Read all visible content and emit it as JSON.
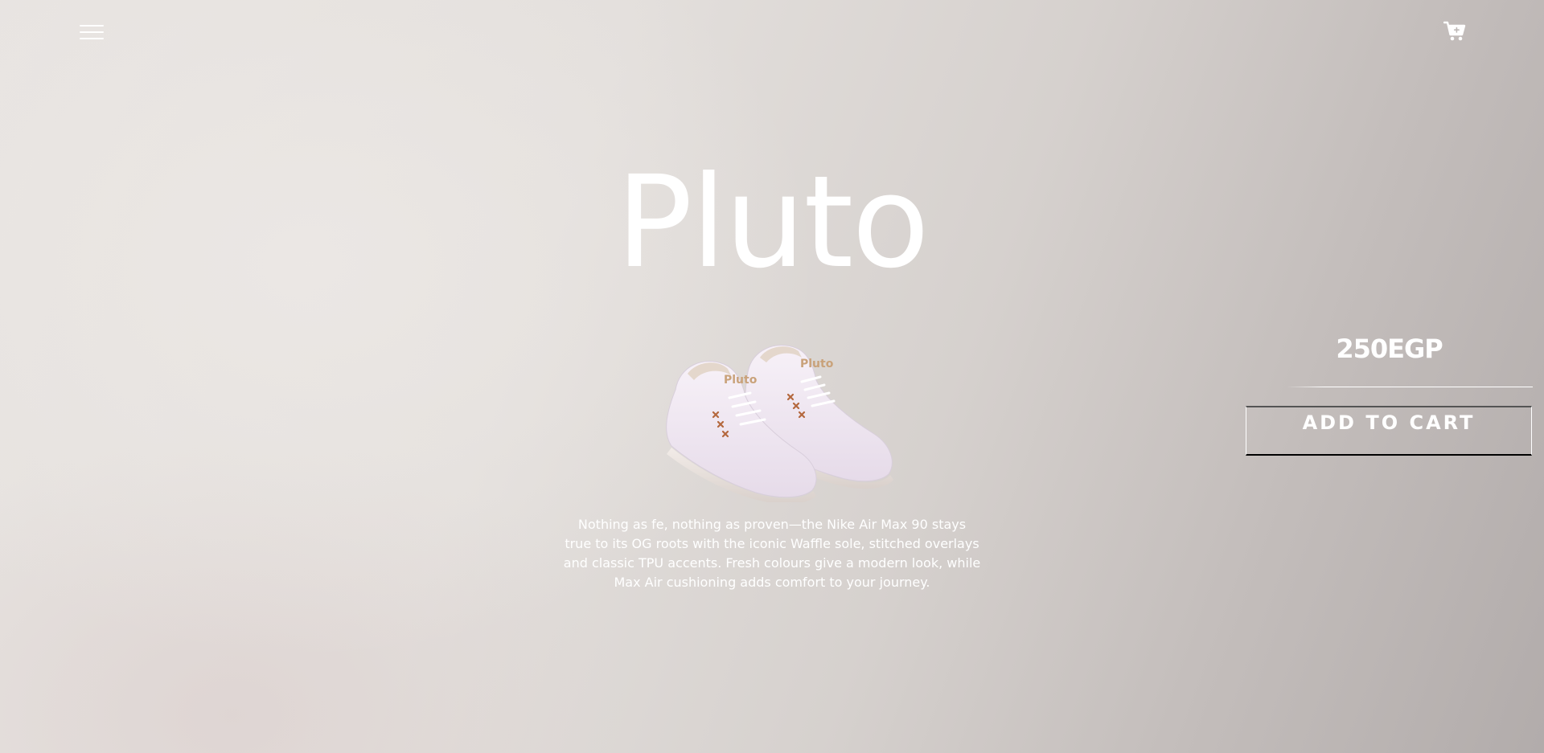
{
  "header": {
    "menu_icon": "hamburger-menu-icon",
    "cart_icon": "shopping-cart-icon"
  },
  "product": {
    "name": "Pluto",
    "image_alt": "shoe-image",
    "description": "Nothing as fe, nothing as proven—the Nike Air Max 90 stays true to its OG roots with the iconic Waffle sole, stitched overlays and classic TPU accents. Fresh colours give a modern look, while Max Air cushioning adds comfort to your journey.",
    "price": "250EGP",
    "add_to_cart_label": "ADD TO CART"
  },
  "colors": {
    "text": "#ffffff",
    "background_light": "#e8e4e1",
    "background_dark": "#b2acab",
    "shoe_body": "#f1e8f3",
    "accent_stitch": "#b4683e",
    "logo_gold": "#c9a27a"
  }
}
